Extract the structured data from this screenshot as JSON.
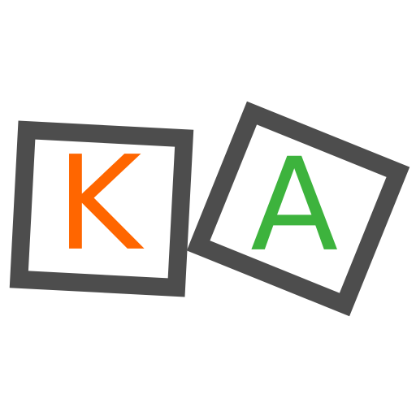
{
  "blocks": [
    {
      "letter": "K",
      "letter_color": "#ff6600"
    },
    {
      "letter": "A",
      "letter_color": "#3db33d"
    }
  ],
  "colors": {
    "background": "#ffffff",
    "block_frame": "#4d4d4d",
    "block_face": "#ffffff"
  }
}
